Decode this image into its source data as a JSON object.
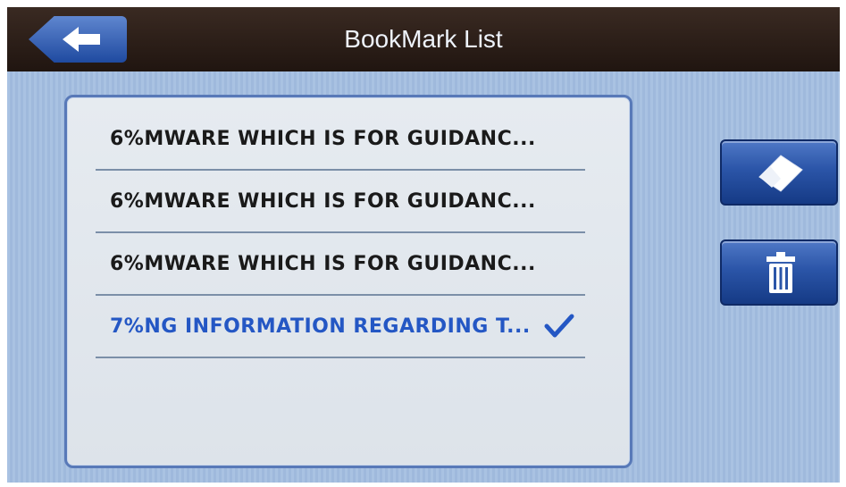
{
  "header": {
    "title": "BookMark List",
    "back_icon": "back-arrow-icon"
  },
  "bookmarks": [
    {
      "label": "6%MWARE WHICH IS FOR GUIDANC...",
      "selected": false
    },
    {
      "label": "6%MWARE WHICH IS FOR GUIDANC...",
      "selected": false
    },
    {
      "label": "6%MWARE WHICH IS FOR GUIDANC...",
      "selected": false
    },
    {
      "label": "7%NG INFORMATION REGARDING T...",
      "selected": true
    }
  ],
  "actions": {
    "edit_icon": "eraser-icon",
    "delete_icon": "trash-icon"
  },
  "colors": {
    "selected_text": "#2457c4",
    "button_blue": "#2b55a8",
    "titlebar": "#2a1c16"
  }
}
